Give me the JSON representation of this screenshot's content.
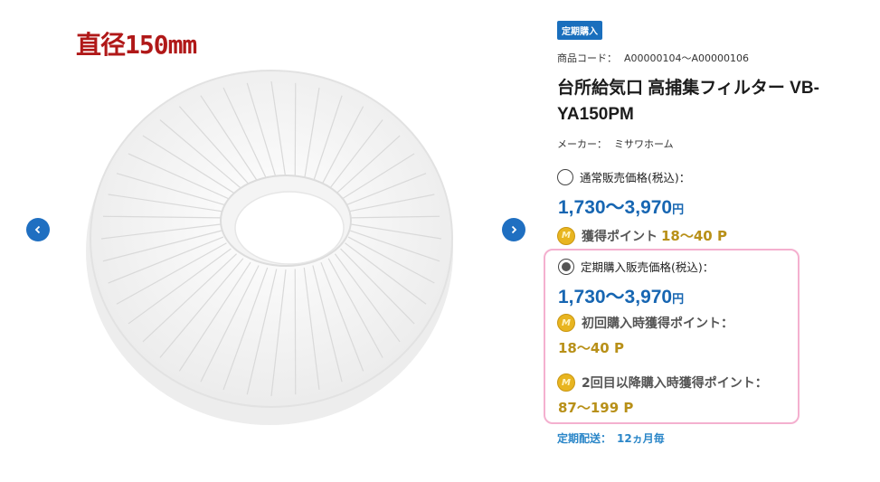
{
  "gallery": {
    "diameter_label": "直径150mm",
    "prev_icon": "chevron-left-icon",
    "next_icon": "chevron-right-icon"
  },
  "product": {
    "badge": "定期購入",
    "code_label": "商品コード：",
    "code_value": "A00000104〜A00000106",
    "title": "台所給気口 高捕集フィルター VB-YA150PM",
    "maker_label": "メーカー：",
    "maker_value": "ミサワホーム"
  },
  "normal": {
    "label": "通常販売価格(税込)：",
    "price": "1,730〜3,970",
    "yen": "円",
    "points_label": "獲得ポイント",
    "points_value": "18〜40 P",
    "selected": false
  },
  "subscription": {
    "label": "定期購入販売価格(税込)：",
    "price": "1,730〜3,970",
    "yen": "円",
    "first_points_label": "初回購入時獲得ポイント：",
    "first_points_value": "18〜40 P",
    "repeat_points_label": "2回目以降購入時獲得ポイント：",
    "repeat_points_value": "87〜199 P",
    "selected": true
  },
  "delivery": {
    "label": "定期配送：",
    "value": "12ヵ月毎"
  },
  "colors": {
    "accent_blue": "#1766b2",
    "badge_blue": "#1a6fbd",
    "point_gold": "#b89018",
    "highlight_pink": "#f4b0cf",
    "diameter_red": "#b01818"
  },
  "icons": {
    "coin": "point-coin-icon",
    "coin_letter": "M"
  }
}
